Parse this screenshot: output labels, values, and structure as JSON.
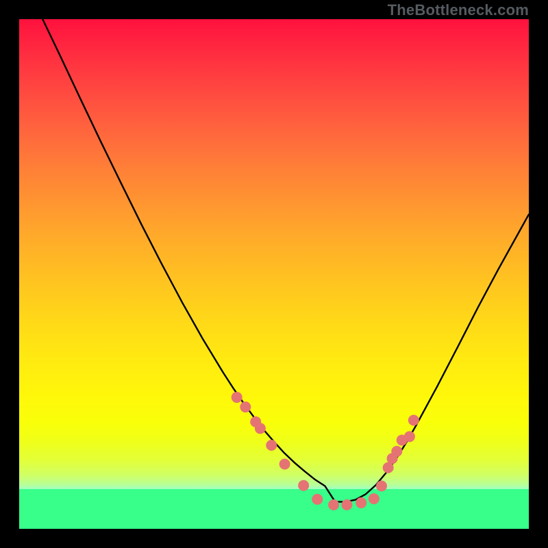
{
  "attribution": "TheBottleneck.com",
  "chart_data": {
    "type": "line",
    "title": "",
    "xlabel": "",
    "ylabel": "",
    "xlim": [
      0,
      100
    ],
    "ylim": [
      0,
      100
    ],
    "grid": false,
    "legend": false,
    "annotations": [],
    "note": "Axes are unlabeled; x/y given as percentage of visible plot area (0=left/bottom, 100=right/top). Curve reaches its minimum near x≈62 with y≈5.",
    "series": [
      {
        "name": "curve",
        "color": "#000000",
        "x": [
          4.6,
          8,
          12,
          16,
          20,
          24,
          28,
          32,
          36,
          40,
          42,
          44,
          46,
          48,
          50,
          52,
          54,
          56,
          58,
          60,
          62,
          64,
          66,
          68,
          70,
          72,
          74,
          76,
          78,
          82,
          86,
          90,
          94,
          98,
          100
        ],
        "y": [
          100,
          92.9,
          84.4,
          76.0,
          67.8,
          59.7,
          51.9,
          44.4,
          37.3,
          30.7,
          27.6,
          24.7,
          22.0,
          19.4,
          17.1,
          14.9,
          13.0,
          11.3,
          9.7,
          8.4,
          5.3,
          5.3,
          5.7,
          6.8,
          8.6,
          11.0,
          13.8,
          17.0,
          20.5,
          27.9,
          35.6,
          43.4,
          50.9,
          58.1,
          61.7
        ]
      }
    ],
    "markers": {
      "name": "dots",
      "color": "#e57373",
      "radius_px": 8,
      "x": [
        42.7,
        44.4,
        46.4,
        47.3,
        49.5,
        52.1,
        55.8,
        58.5,
        61.7,
        64.3,
        67.1,
        69.6,
        71.1,
        72.4,
        73.2,
        74.1,
        75.1,
        76.6,
        77.4
      ],
      "y": [
        25.8,
        23.9,
        21.0,
        19.7,
        16.4,
        12.7,
        8.5,
        5.8,
        4.7,
        4.7,
        5.1,
        5.9,
        8.4,
        12.0,
        13.8,
        15.2,
        17.4,
        18.1,
        21.3
      ]
    },
    "background": {
      "gradient": [
        "#ff113e",
        "#ff9830",
        "#fff70a",
        "#a1ffc1"
      ],
      "band": {
        "color": "#37ff8a",
        "y_range_pct": [
          0,
          7.8
        ]
      }
    }
  }
}
